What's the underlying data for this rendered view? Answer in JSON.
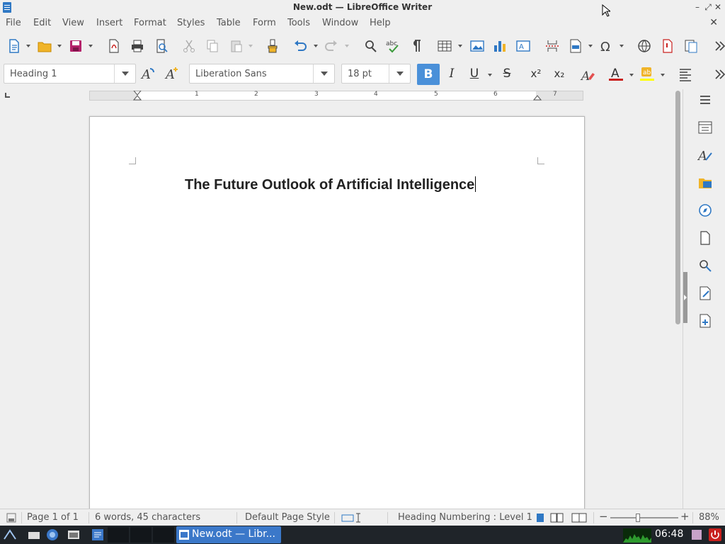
{
  "window": {
    "title": "New.odt — LibreOffice Writer"
  },
  "menubar": {
    "items": [
      "File",
      "Edit",
      "View",
      "Insert",
      "Format",
      "Styles",
      "Table",
      "Form",
      "Tools",
      "Window",
      "Help"
    ]
  },
  "formatting": {
    "paragraph_style": "Heading 1",
    "font_name": "Liberation Sans",
    "font_size": "18 pt",
    "bold": "B",
    "italic": "I",
    "underline": "U",
    "strikethrough": "S",
    "superscript": "x²",
    "subscript": "x₂"
  },
  "ruler": {
    "numbers": [
      "1",
      "2",
      "3",
      "4",
      "5",
      "6",
      "7"
    ]
  },
  "document": {
    "heading": "The Future Outlook of Artificial Intelligence"
  },
  "statusbar": {
    "page": "Page 1 of 1",
    "word_count": "6 words, 45 characters",
    "page_style": "Default Page Style",
    "outline": "Heading Numbering : Level 1",
    "zoom": "88%"
  },
  "taskbar": {
    "task_label": "New.odt — Libr...",
    "clock": "06:48"
  },
  "colors": {
    "accent": "#4a90d9",
    "font_color": "#c9211e",
    "highlight": "#ffff00",
    "taskbar": "#1f2429"
  }
}
